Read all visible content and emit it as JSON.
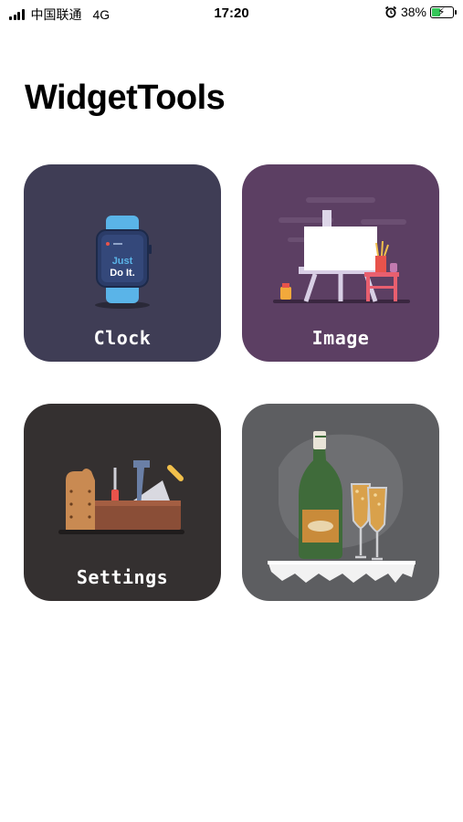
{
  "status_bar": {
    "carrier": "中国联通",
    "network": "4G",
    "time": "17:20",
    "battery_percent": "38%",
    "battery_level": 0.38
  },
  "title": "WidgetTools",
  "cards": [
    {
      "label": "Clock",
      "watch_text_line1": "Just",
      "watch_text_line2": "Do It."
    },
    {
      "label": "Image"
    },
    {
      "label": "Settings"
    },
    {
      "label": ""
    }
  ]
}
